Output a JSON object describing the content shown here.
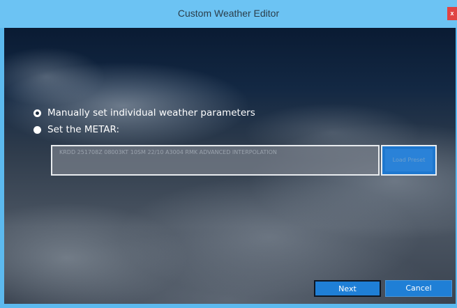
{
  "window": {
    "title": "Custom Weather Editor",
    "close_symbol": "x"
  },
  "options": [
    {
      "label": "Manually set individual weather parameters",
      "selected": true
    },
    {
      "label": "Set the METAR:",
      "selected": false
    }
  ],
  "metar": {
    "value": "KRDD 251708Z 08003KT 10SM 22/10 A3004 RMK ADVANCED INTERPOLATION"
  },
  "buttons": {
    "load": "Load Preset",
    "next": "Next",
    "cancel": "Cancel"
  },
  "icons": {
    "close": "close-icon",
    "radio_selected": "radio-selected-icon",
    "radio_unselected": "radio-unselected-icon"
  },
  "colors": {
    "titlebar": "#6cc3f3",
    "accent_button": "#1f7fd6",
    "close_button": "#e04343"
  }
}
